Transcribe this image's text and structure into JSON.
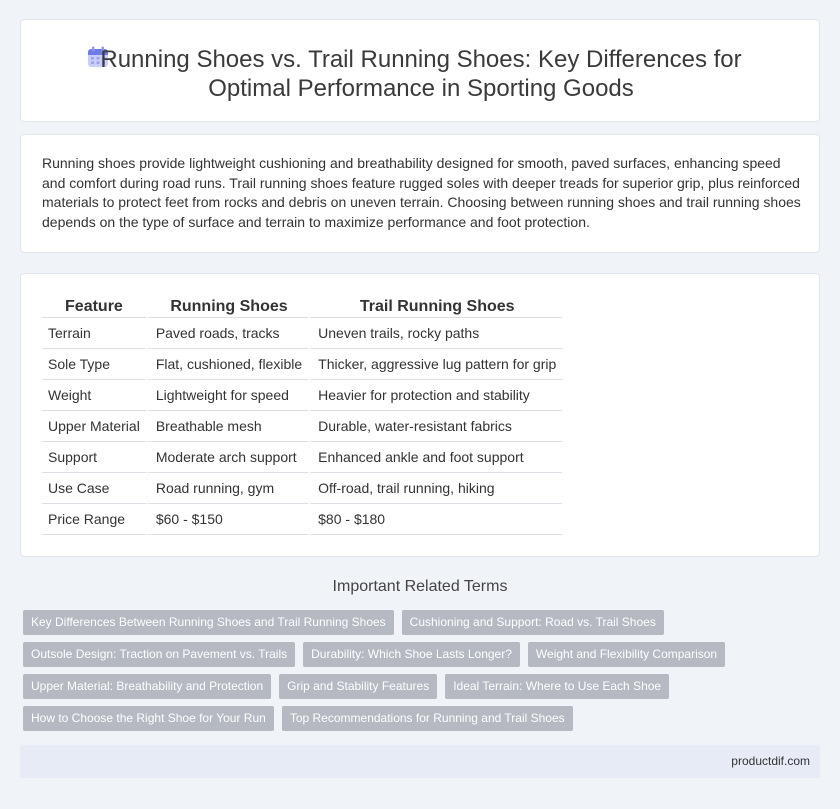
{
  "header": {
    "title": "Running Shoes vs. Trail Running Shoes: Key Differences for Optimal Performance in Sporting Goods",
    "icon": "calendar-icon"
  },
  "intro": "Running shoes provide lightweight cushioning and breathability designed for smooth, paved surfaces, enhancing speed and comfort during road runs. Trail running shoes feature rugged soles with deeper treads for superior grip, plus reinforced materials to protect feet from rocks and debris on uneven terrain. Choosing between running shoes and trail running shoes depends on the type of surface and terrain to maximize performance and foot protection.",
  "table": {
    "headers": [
      "Feature",
      "Running Shoes",
      "Trail Running Shoes"
    ],
    "rows": [
      [
        "Terrain",
        "Paved roads, tracks",
        "Uneven trails, rocky paths"
      ],
      [
        "Sole Type",
        "Flat, cushioned, flexible",
        "Thicker, aggressive lug pattern for grip"
      ],
      [
        "Weight",
        "Lightweight for speed",
        "Heavier for protection and stability"
      ],
      [
        "Upper Material",
        "Breathable mesh",
        "Durable, water-resistant fabrics"
      ],
      [
        "Support",
        "Moderate arch support",
        "Enhanced ankle and foot support"
      ],
      [
        "Use Case",
        "Road running, gym",
        "Off-road, trail running, hiking"
      ],
      [
        "Price Range",
        "$60 - $150",
        "$80 - $180"
      ]
    ]
  },
  "related": {
    "title": "Important Related Terms",
    "rows": [
      [
        "Key Differences Between Running Shoes and Trail Running Shoes",
        "Cushioning and Support: Road vs. Trail Shoes"
      ],
      [
        "Outsole Design: Traction on Pavement vs. Trails",
        "Durability: Which Shoe Lasts Longer?",
        "Weight and Flexibility Comparison"
      ],
      [
        "Upper Material: Breathability and Protection",
        "Grip and Stability Features",
        "Ideal Terrain: Where to Use Each Shoe"
      ],
      [
        "How to Choose the Right Shoe for Your Run",
        "Top Recommendations for Running and Trail Shoes"
      ]
    ]
  },
  "footer": {
    "site": "productdif.com"
  },
  "colors": {
    "tag_bg": "#b4b9c2",
    "page_bg": "#f0f3f8",
    "footer_bg": "#e6ebf5"
  }
}
